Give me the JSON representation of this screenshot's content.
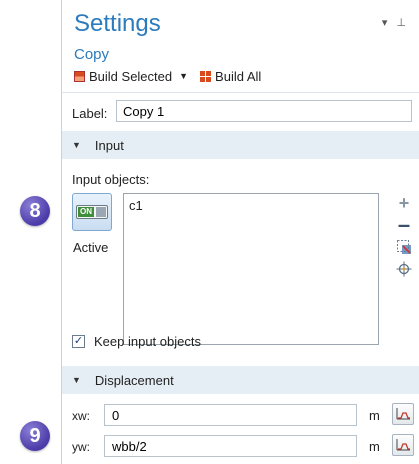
{
  "callouts": {
    "step_input": "8",
    "step_displacement": "9"
  },
  "settings": {
    "title": "Settings",
    "title_tools": "▾ ⊥",
    "subtitle": "Copy",
    "build_selected_label": "Build Selected",
    "build_all_label": "Build All",
    "label_caption": "Label:",
    "label_value": "Copy 1"
  },
  "input_section": {
    "header": "Input",
    "objects_label": "Input objects:",
    "active_toggle_text": "ON",
    "active_label": "Active",
    "objects": [
      "c1"
    ],
    "keep_input_label": "Keep input objects",
    "keep_input_checked": true
  },
  "displacement_section": {
    "header": "Displacement",
    "fields": [
      {
        "label": "xw:",
        "value": "0",
        "unit": "m"
      },
      {
        "label": "yw:",
        "value": "wbb/2",
        "unit": "m"
      }
    ]
  },
  "icons": {
    "collapse": "triangle-down-icon",
    "add": "plus-icon",
    "remove": "minus-icon",
    "clear_selection": "clear-selection-icon",
    "zoom_to_selection": "zoom-selection-icon",
    "plot": "plot-icon"
  },
  "colors": {
    "accent_title": "#2b7bbd",
    "section_header_bg": "#e6eef5",
    "callout": "#4b3aa8",
    "build_icon": "#d94a1d"
  }
}
